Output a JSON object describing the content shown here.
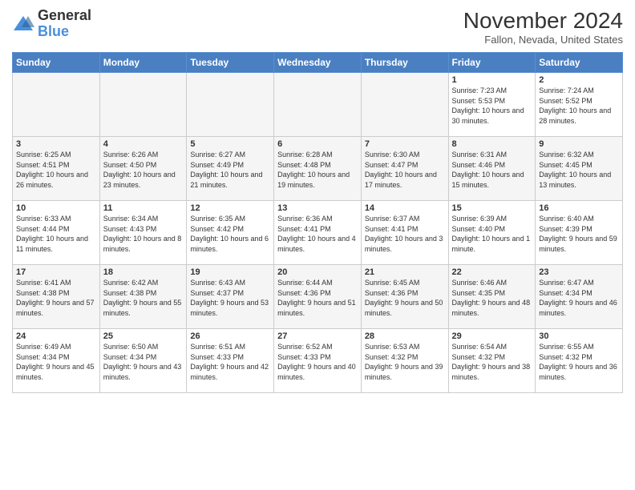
{
  "logo": {
    "general": "General",
    "blue": "Blue"
  },
  "title": "November 2024",
  "location": "Fallon, Nevada, United States",
  "days_of_week": [
    "Sunday",
    "Monday",
    "Tuesday",
    "Wednesday",
    "Thursday",
    "Friday",
    "Saturday"
  ],
  "weeks": [
    [
      {
        "day": "",
        "info": ""
      },
      {
        "day": "",
        "info": ""
      },
      {
        "day": "",
        "info": ""
      },
      {
        "day": "",
        "info": ""
      },
      {
        "day": "",
        "info": ""
      },
      {
        "day": "1",
        "info": "Sunrise: 7:23 AM\nSunset: 5:53 PM\nDaylight: 10 hours and 30 minutes."
      },
      {
        "day": "2",
        "info": "Sunrise: 7:24 AM\nSunset: 5:52 PM\nDaylight: 10 hours and 28 minutes."
      }
    ],
    [
      {
        "day": "3",
        "info": "Sunrise: 6:25 AM\nSunset: 4:51 PM\nDaylight: 10 hours and 26 minutes."
      },
      {
        "day": "4",
        "info": "Sunrise: 6:26 AM\nSunset: 4:50 PM\nDaylight: 10 hours and 23 minutes."
      },
      {
        "day": "5",
        "info": "Sunrise: 6:27 AM\nSunset: 4:49 PM\nDaylight: 10 hours and 21 minutes."
      },
      {
        "day": "6",
        "info": "Sunrise: 6:28 AM\nSunset: 4:48 PM\nDaylight: 10 hours and 19 minutes."
      },
      {
        "day": "7",
        "info": "Sunrise: 6:30 AM\nSunset: 4:47 PM\nDaylight: 10 hours and 17 minutes."
      },
      {
        "day": "8",
        "info": "Sunrise: 6:31 AM\nSunset: 4:46 PM\nDaylight: 10 hours and 15 minutes."
      },
      {
        "day": "9",
        "info": "Sunrise: 6:32 AM\nSunset: 4:45 PM\nDaylight: 10 hours and 13 minutes."
      }
    ],
    [
      {
        "day": "10",
        "info": "Sunrise: 6:33 AM\nSunset: 4:44 PM\nDaylight: 10 hours and 11 minutes."
      },
      {
        "day": "11",
        "info": "Sunrise: 6:34 AM\nSunset: 4:43 PM\nDaylight: 10 hours and 8 minutes."
      },
      {
        "day": "12",
        "info": "Sunrise: 6:35 AM\nSunset: 4:42 PM\nDaylight: 10 hours and 6 minutes."
      },
      {
        "day": "13",
        "info": "Sunrise: 6:36 AM\nSunset: 4:41 PM\nDaylight: 10 hours and 4 minutes."
      },
      {
        "day": "14",
        "info": "Sunrise: 6:37 AM\nSunset: 4:41 PM\nDaylight: 10 hours and 3 minutes."
      },
      {
        "day": "15",
        "info": "Sunrise: 6:39 AM\nSunset: 4:40 PM\nDaylight: 10 hours and 1 minute."
      },
      {
        "day": "16",
        "info": "Sunrise: 6:40 AM\nSunset: 4:39 PM\nDaylight: 9 hours and 59 minutes."
      }
    ],
    [
      {
        "day": "17",
        "info": "Sunrise: 6:41 AM\nSunset: 4:38 PM\nDaylight: 9 hours and 57 minutes."
      },
      {
        "day": "18",
        "info": "Sunrise: 6:42 AM\nSunset: 4:38 PM\nDaylight: 9 hours and 55 minutes."
      },
      {
        "day": "19",
        "info": "Sunrise: 6:43 AM\nSunset: 4:37 PM\nDaylight: 9 hours and 53 minutes."
      },
      {
        "day": "20",
        "info": "Sunrise: 6:44 AM\nSunset: 4:36 PM\nDaylight: 9 hours and 51 minutes."
      },
      {
        "day": "21",
        "info": "Sunrise: 6:45 AM\nSunset: 4:36 PM\nDaylight: 9 hours and 50 minutes."
      },
      {
        "day": "22",
        "info": "Sunrise: 6:46 AM\nSunset: 4:35 PM\nDaylight: 9 hours and 48 minutes."
      },
      {
        "day": "23",
        "info": "Sunrise: 6:47 AM\nSunset: 4:34 PM\nDaylight: 9 hours and 46 minutes."
      }
    ],
    [
      {
        "day": "24",
        "info": "Sunrise: 6:49 AM\nSunset: 4:34 PM\nDaylight: 9 hours and 45 minutes."
      },
      {
        "day": "25",
        "info": "Sunrise: 6:50 AM\nSunset: 4:34 PM\nDaylight: 9 hours and 43 minutes."
      },
      {
        "day": "26",
        "info": "Sunrise: 6:51 AM\nSunset: 4:33 PM\nDaylight: 9 hours and 42 minutes."
      },
      {
        "day": "27",
        "info": "Sunrise: 6:52 AM\nSunset: 4:33 PM\nDaylight: 9 hours and 40 minutes."
      },
      {
        "day": "28",
        "info": "Sunrise: 6:53 AM\nSunset: 4:32 PM\nDaylight: 9 hours and 39 minutes."
      },
      {
        "day": "29",
        "info": "Sunrise: 6:54 AM\nSunset: 4:32 PM\nDaylight: 9 hours and 38 minutes."
      },
      {
        "day": "30",
        "info": "Sunrise: 6:55 AM\nSunset: 4:32 PM\nDaylight: 9 hours and 36 minutes."
      }
    ]
  ]
}
